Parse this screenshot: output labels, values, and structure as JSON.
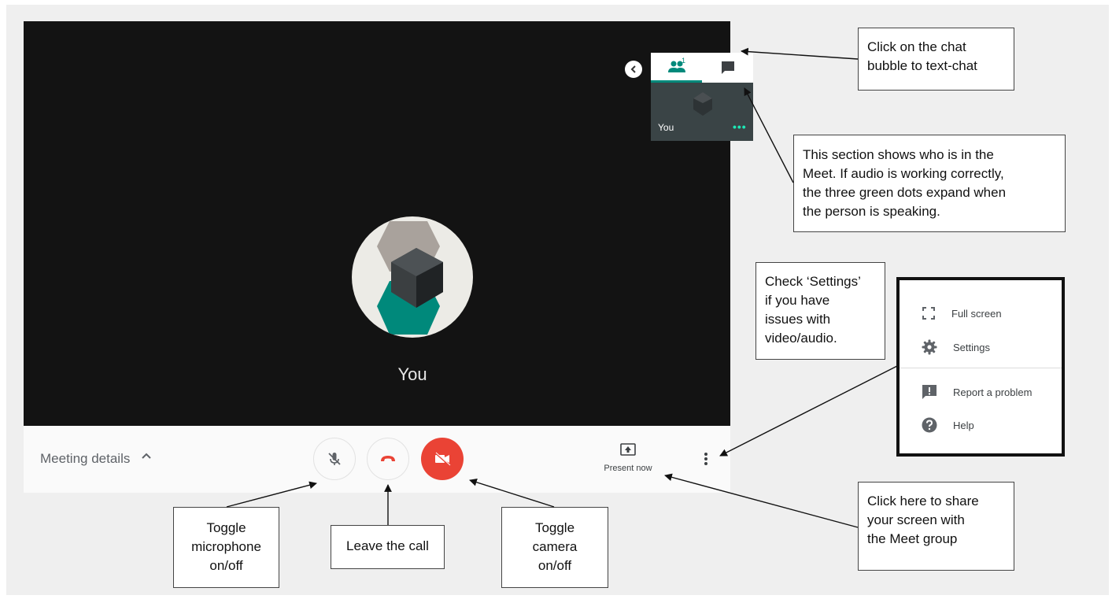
{
  "meet": {
    "self_label": "You",
    "participants": {
      "count_badge": "1",
      "tile_name": "You",
      "tile_status": "•••"
    },
    "controls": {
      "meeting_details_label": "Meeting details",
      "present_now_label": "Present now"
    }
  },
  "menu": {
    "items": [
      {
        "label": "Full screen",
        "icon": "fullscreen-icon"
      },
      {
        "label": "Settings",
        "icon": "gear-icon"
      },
      {
        "label": "Report a problem",
        "icon": "feedback-icon"
      },
      {
        "label": "Help",
        "icon": "help-icon"
      }
    ]
  },
  "callouts": {
    "chat": [
      "Click on the chat",
      "bubble to text-chat"
    ],
    "participants": [
      "This section shows who is in the",
      "Meet. If audio is working correctly,",
      "the three green dots expand when",
      "the person is speaking."
    ],
    "settings": [
      "Check ‘Settings’",
      "if you have",
      "issues with",
      "video/audio."
    ],
    "share": [
      "Click here to share",
      "your screen with",
      "the Meet group"
    ],
    "mic": [
      "Toggle",
      "microphone",
      "on/off"
    ],
    "leave": [
      "Leave the call"
    ],
    "camera": [
      "Toggle",
      "camera",
      "on/off"
    ]
  },
  "colors": {
    "video_bg": "#131313",
    "accent_teal": "#00897b",
    "hangup_red": "#ea4335",
    "speaking_dots": "#1de9b6"
  }
}
